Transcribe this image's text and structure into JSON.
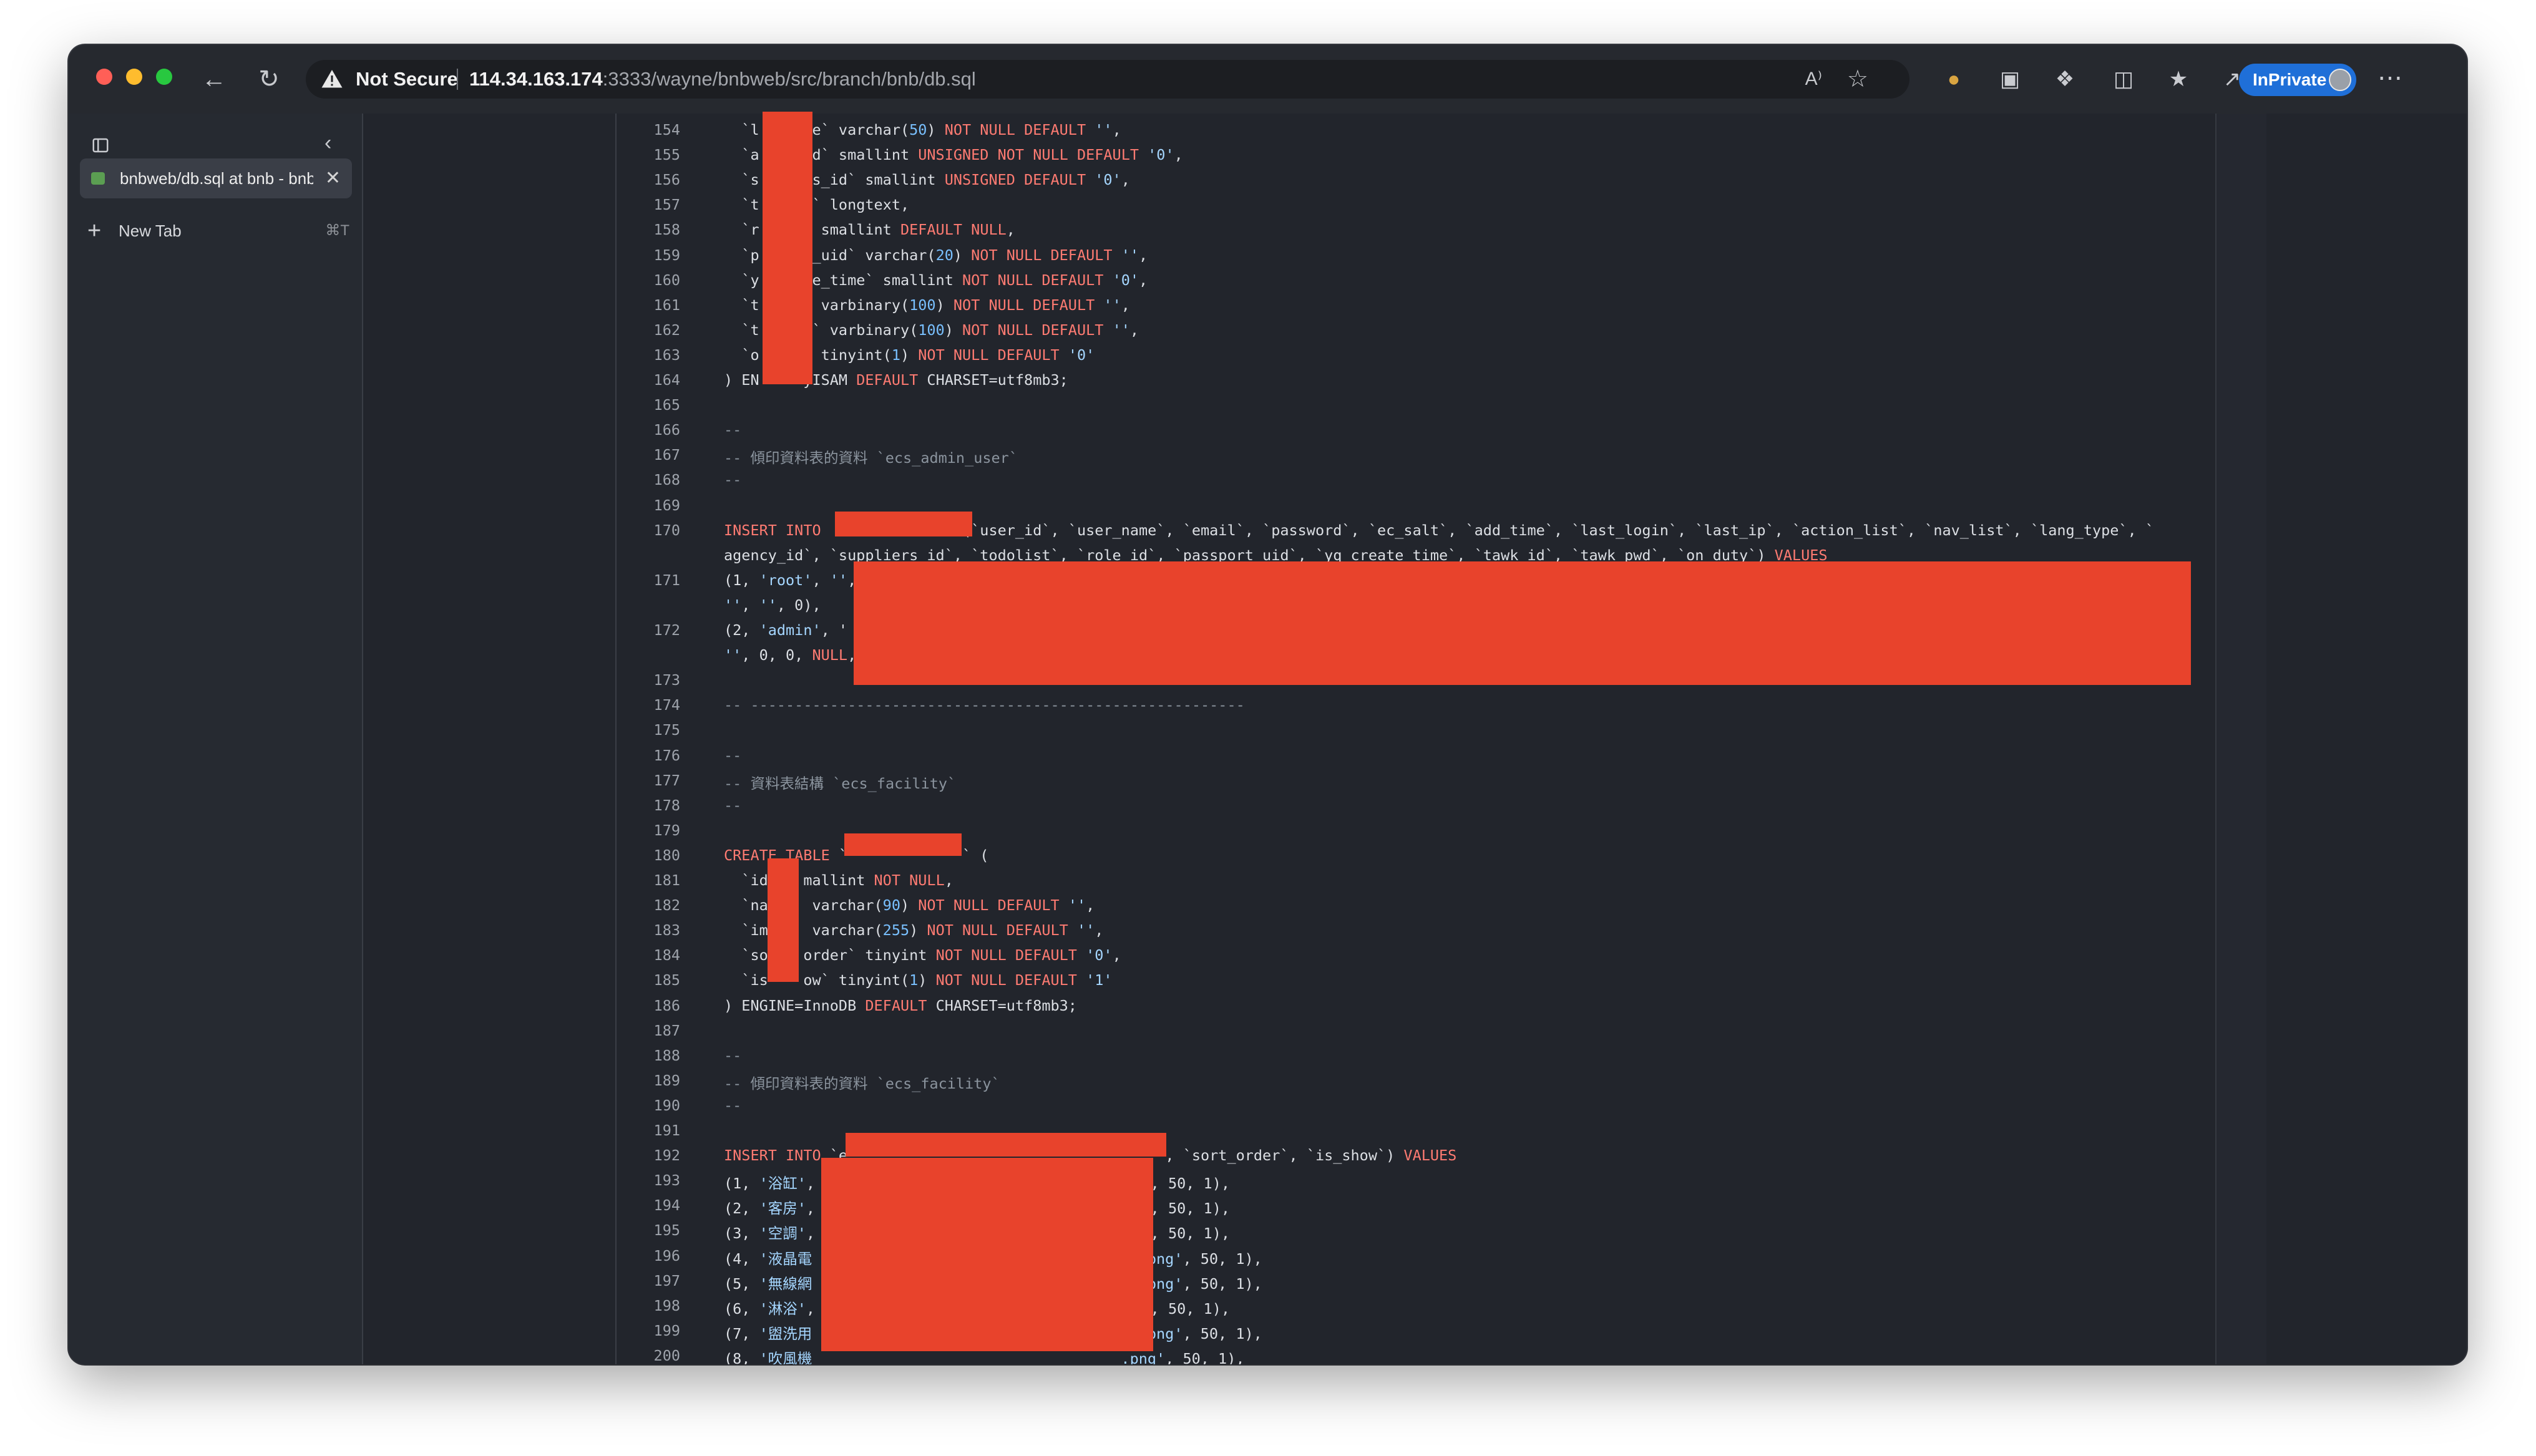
{
  "browser": {
    "security_label": "Not Secure",
    "url_host": "114.34.163.174",
    "url_rest": ":3333/wayne/bnbweb/src/branch/bnb/db.sql",
    "read_aloud_label": "A⁾",
    "inprivate_label": "InPrivate",
    "more_label": "⋯"
  },
  "sidebar": {
    "tab_title": "bnbweb/db.sql at bnb - bnbweb",
    "new_tab_label": "New Tab",
    "new_tab_shortcut": "⌘T"
  },
  "code_lines": [
    {
      "n": "154",
      "t": "  `l     pe` varchar(50) NOT NULL DEFAULT '',"
    },
    {
      "n": "155",
      "t": "  `a     id` smallint UNSIGNED NOT NULL DEFAULT '0',"
    },
    {
      "n": "156",
      "t": "  `s     rs_id` smallint UNSIGNED DEFAULT '0',"
    },
    {
      "n": "157",
      "t": "  `t     t` longtext,"
    },
    {
      "n": "158",
      "t": "  `r     ` smallint DEFAULT NULL,"
    },
    {
      "n": "159",
      "t": "  `p     t_uid` varchar(20) NOT NULL DEFAULT '',"
    },
    {
      "n": "160",
      "t": "  `y     te_time` smallint NOT NULL DEFAULT '0',"
    },
    {
      "n": "161",
      "t": "  `t     ` varbinary(100) NOT NULL DEFAULT '',"
    },
    {
      "n": "162",
      "t": "  `t     d` varbinary(100) NOT NULL DEFAULT '',"
    },
    {
      "n": "163",
      "t": "  `o     ` tinyint(1) NOT NULL DEFAULT '0'"
    },
    {
      "n": "164",
      "t": ") EN     yISAM DEFAULT CHARSET=utf8mb3;"
    },
    {
      "n": "165",
      "t": ""
    },
    {
      "n": "166",
      "t": "--"
    },
    {
      "n": "167",
      "t": "-- 傾印資料表的資料 `ecs_admin_user`"
    },
    {
      "n": "168",
      "t": "--"
    },
    {
      "n": "169",
      "t": ""
    },
    {
      "n": "170",
      "t": "INSERT INTO                (`user_id`, `user_name`, `email`, `password`, `ec_salt`, `add_time`, `last_login`, `last_ip`, `action_list`, `nav_list`, `lang_type`, `"
    },
    {
      "n": "",
      "t": "agency_id`, `suppliers_id`, `todolist`, `role_id`, `passport_uid`, `yq_create_time`, `tawk_id`, `tawk_pwd`, `on_duty`) VALUES"
    },
    {
      "n": "171",
      "t": "(1, 'root', '',"
    },
    {
      "n": "",
      "t": "'', '', 0),"
    },
    {
      "n": "172",
      "t": "(2, 'admin', '"
    },
    {
      "n": "",
      "t": "'', 0, 0, NULL,"
    },
    {
      "n": "173",
      "t": ""
    },
    {
      "n": "174",
      "t": "-- --------------------------------------------------------"
    },
    {
      "n": "175",
      "t": ""
    },
    {
      "n": "176",
      "t": "--"
    },
    {
      "n": "177",
      "t": "-- 資料表結構 `ecs_facility`"
    },
    {
      "n": "178",
      "t": "--"
    },
    {
      "n": "179",
      "t": ""
    },
    {
      "n": "180",
      "t": "CREATE TABLE `             ` ("
    },
    {
      "n": "181",
      "t": "  `id    mallint NOT NULL,"
    },
    {
      "n": "182",
      "t": "  `na     varchar(90) NOT NULL DEFAULT '',"
    },
    {
      "n": "183",
      "t": "  `im     varchar(255) NOT NULL DEFAULT '',"
    },
    {
      "n": "184",
      "t": "  `so    order` tinyint NOT NULL DEFAULT '0',"
    },
    {
      "n": "185",
      "t": "  `is    ow` tinyint(1) NOT NULL DEFAULT '1'"
    },
    {
      "n": "186",
      "t": ") ENGINE=InnoDB DEFAULT CHARSET=utf8mb3;"
    },
    {
      "n": "187",
      "t": ""
    },
    {
      "n": "188",
      "t": "--"
    },
    {
      "n": "189",
      "t": "-- 傾印資料表的資料 `ecs_facility`"
    },
    {
      "n": "190",
      "t": "--"
    },
    {
      "n": "191",
      "t": ""
    },
    {
      "n": "192",
      "t": "INSERT INTO `e                                    , `sort_order`, `is_show`) VALUES"
    },
    {
      "n": "193",
      "t": "(1, '浴缸',                                   ng', 50, 1),"
    },
    {
      "n": "194",
      "t": "(2, '客房',                                   ng', 50, 1),"
    },
    {
      "n": "195",
      "t": "(3, '空調',                                   ng', 50, 1),"
    },
    {
      "n": "196",
      "t": "(4, '液晶電                                   31.png', 50, 1),"
    },
    {
      "n": "197",
      "t": "(5, '無線網                                   13.png', 50, 1),"
    },
    {
      "n": "198",
      "t": "(6, '淋浴',                                   ng', 50, 1),"
    },
    {
      "n": "199",
      "t": "(7, '盥洗用                                   09.png', 50, 1),"
    },
    {
      "n": "200",
      "t": "(8, '吹風機                                   .png', 50, 1),"
    }
  ]
}
